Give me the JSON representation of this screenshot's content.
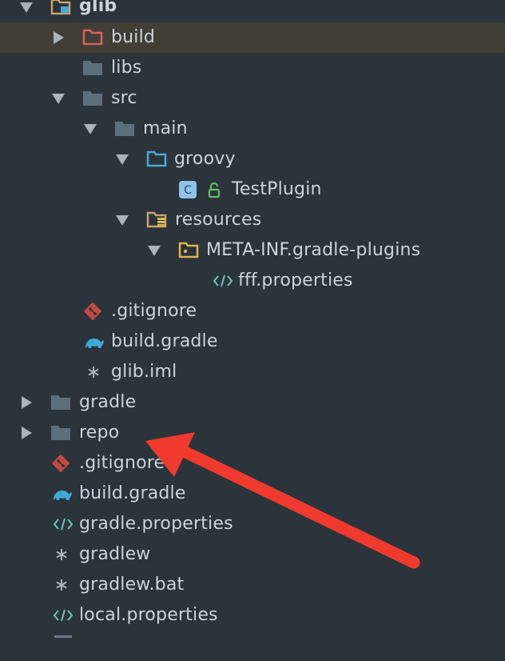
{
  "project": {
    "root": "glib",
    "items": {
      "build": "build",
      "libs": "libs",
      "src": "src",
      "main": "main",
      "groovy": "groovy",
      "testplugin": "TestPlugin",
      "resources": "resources",
      "metainf": "META-INF.gradle-plugins",
      "fff": "fff.properties",
      "gitignore_module": ".gitignore",
      "buildgradle_module": "build.gradle",
      "iml": "glib.iml",
      "gradle": "gradle",
      "repo": "repo",
      "gitignore_root": ".gitignore",
      "buildgradle_root": "build.gradle",
      "gradleprops": "gradle.properties",
      "gradlew": "gradlew",
      "gradlewbat": "gradlew.bat",
      "localprops": "local.properties"
    }
  },
  "colors": {
    "background": "#2b333b",
    "selected_row": "#413e36",
    "annotation_arrow": "#f03a2e"
  }
}
